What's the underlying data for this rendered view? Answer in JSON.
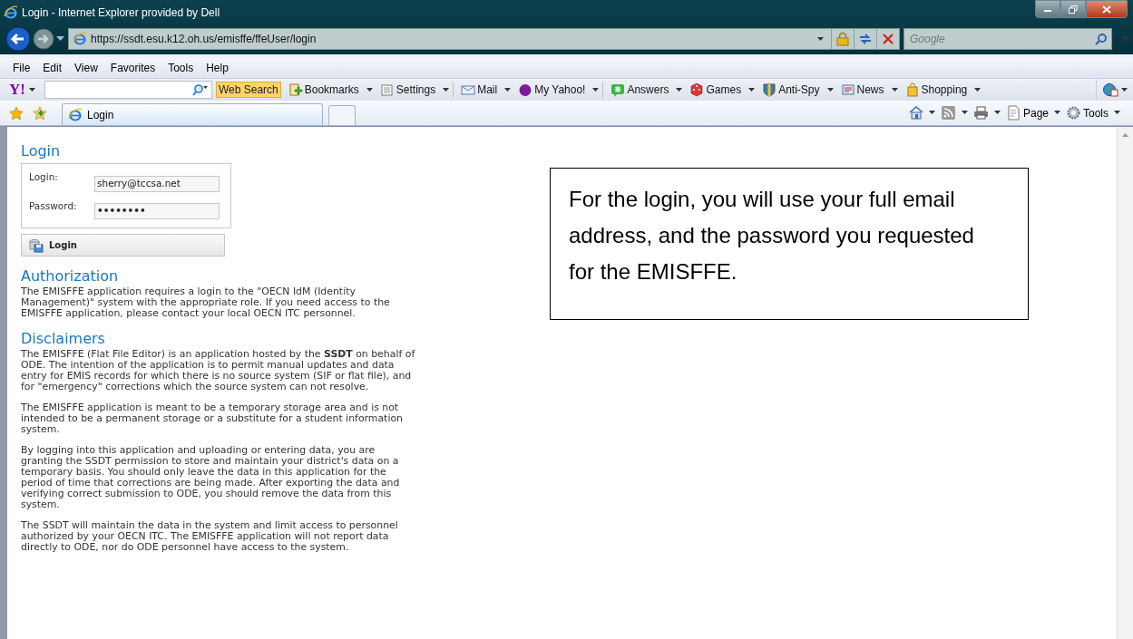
{
  "window": {
    "title": "Login - Internet Explorer provided by Dell"
  },
  "address_bar": {
    "url": "https://ssdt.esu.k12.oh.us/emisffe/ffeUser/login",
    "search_placeholder": "Google"
  },
  "menu": [
    "File",
    "Edit",
    "View",
    "Favorites",
    "Tools",
    "Help"
  ],
  "yahoo_toolbar": {
    "logo": "Y!",
    "search_button": "Web Search",
    "items": [
      {
        "label": "Bookmarks",
        "kind": "bookmarks"
      },
      {
        "label": "Settings",
        "kind": "settings"
      },
      {
        "label": "Mail",
        "kind": "mail"
      },
      {
        "label": "My Yahoo!",
        "kind": "myyahoo"
      },
      {
        "label": "Answers",
        "kind": "answers"
      },
      {
        "label": "Games",
        "kind": "games"
      },
      {
        "label": "Anti-Spy",
        "kind": "antispy"
      },
      {
        "label": "News",
        "kind": "news"
      },
      {
        "label": "Shopping",
        "kind": "shopping"
      }
    ]
  },
  "tabs": [
    {
      "label": "Login",
      "selected": true
    }
  ],
  "command_bar": [
    {
      "kind": "home"
    },
    {
      "kind": "feeds"
    },
    {
      "kind": "print"
    },
    {
      "kind": "page",
      "label": "Page"
    },
    {
      "kind": "tools",
      "label": "Tools"
    }
  ],
  "page": {
    "login_heading": "Login",
    "fields": [
      {
        "label": "Login:",
        "value": "sherry@tccsa.net",
        "kind": "text"
      },
      {
        "label": "Password:",
        "value": "••••••••",
        "kind": "password"
      }
    ],
    "login_button": "Login",
    "sections": [
      {
        "heading": "Authorization",
        "paragraphs": [
          "The EMISFFE application requires a login to the \"OECN IdM (Identity Management)\" system with the appropriate role. If you need access to the EMISFFE application, please contact your local OECN ITC personnel."
        ]
      },
      {
        "heading": "Disclaimers",
        "paragraphs": [
          "The EMISFFE (Flat File Editor) is an application hosted by the **SSDT** on behalf of ODE. The intention of the application is to permit manual updates and data entry for EMIS records for which there is no source system (SIF or flat file), and for \"emergency\" corrections which the source system can not resolve.",
          "The EMISFFE application is meant to be a temporary storage area and is not intended to be a permanent storage or a substitute for a student information system.",
          "By logging into this application and uploading or entering data, you are granting the SSDT permission to store and maintain your district's data on a temporary basis. You should only leave the data in this application for the period of time that corrections are being made. After exporting the data and verifying correct submission to ODE, you should remove the data from this system.",
          "The SSDT will maintain the data in the system and limit access to personnel authorized by your OECN ITC. The EMISFFE application will not report data directly to ODE, nor do ODE personnel have access to the system."
        ]
      }
    ]
  },
  "callout": {
    "text": "For the login, you will use your full email address, and the password you requested for the EMISFFE."
  }
}
